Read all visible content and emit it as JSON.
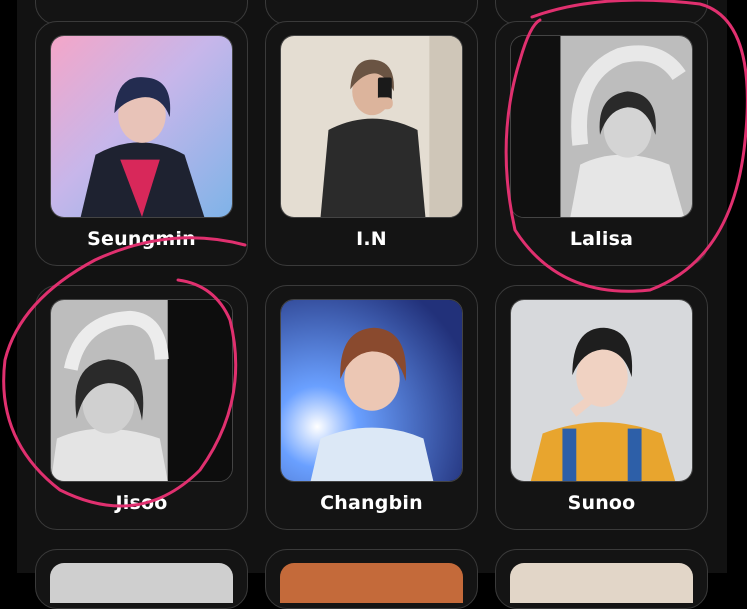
{
  "profiles": [
    {
      "name": "Seungmin",
      "photo": "photo-seungmin",
      "tone": "color"
    },
    {
      "name": "I.N",
      "photo": "photo-in",
      "tone": "color"
    },
    {
      "name": "Lalisa",
      "photo": "photo-lalisa",
      "tone": "grayscale"
    },
    {
      "name": "Jisoo",
      "photo": "photo-jisoo",
      "tone": "grayscale"
    },
    {
      "name": "Changbin",
      "photo": "photo-changbin",
      "tone": "color"
    },
    {
      "name": "Sunoo",
      "photo": "photo-sunoo",
      "tone": "color"
    }
  ],
  "colors": {
    "background": "#121212",
    "card_border": "#3a3a3a",
    "name_text": "#ffffff",
    "annotation_ink": "#e0306f"
  }
}
